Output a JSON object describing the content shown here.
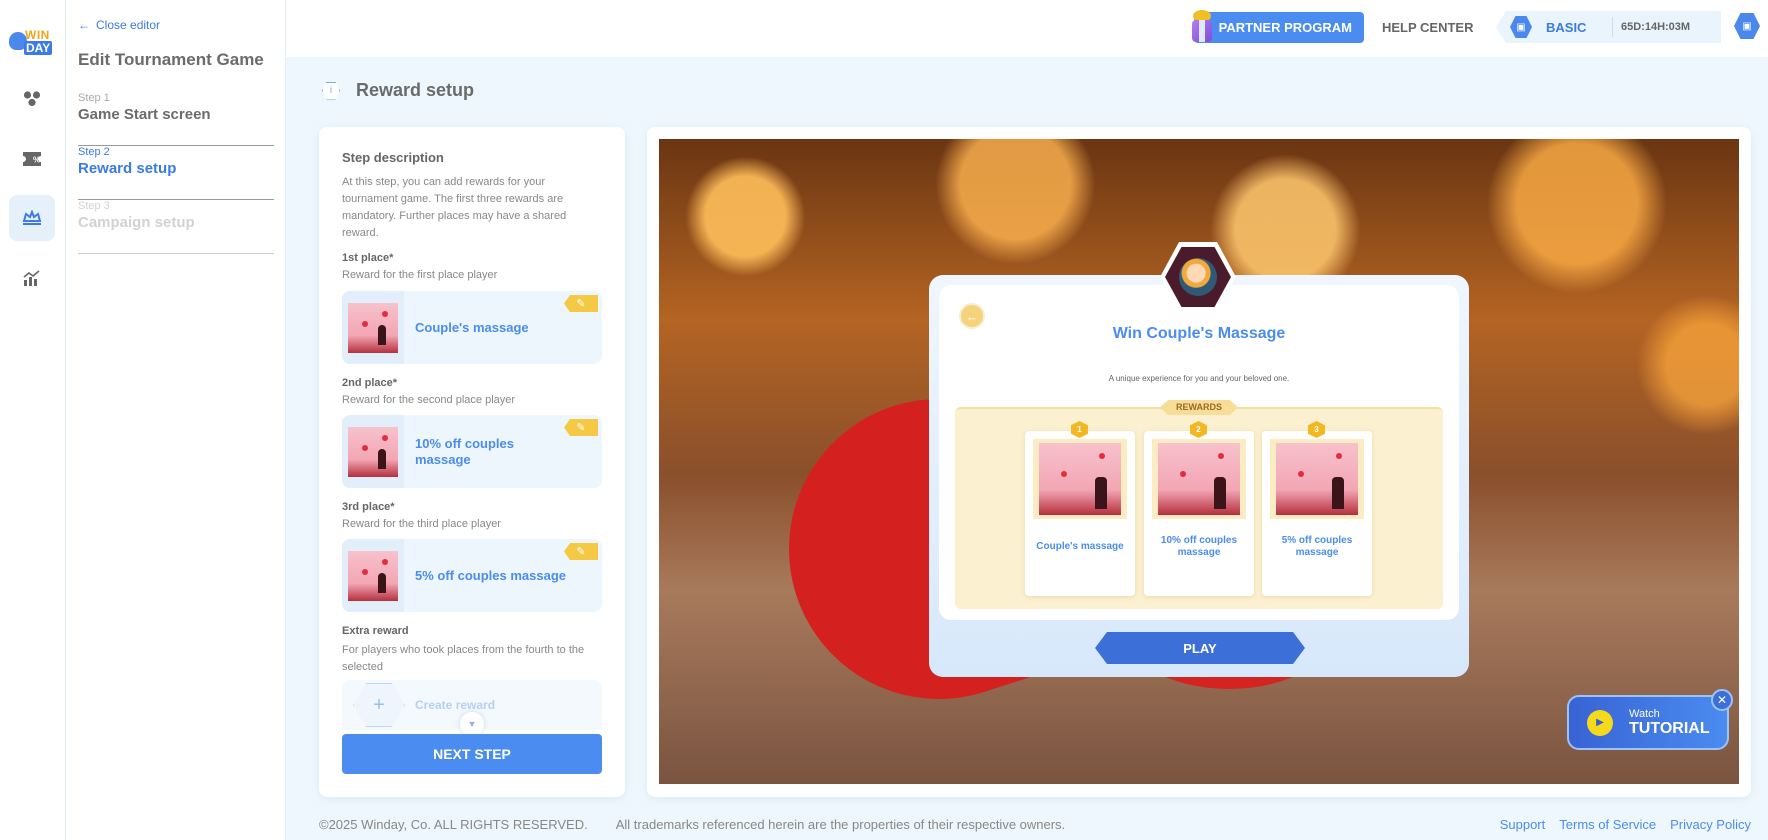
{
  "brand": {
    "logo_top": "WIN",
    "logo_bottom": "DAY"
  },
  "rail": {
    "items": [
      {
        "icon": "apps-icon",
        "active": false
      },
      {
        "icon": "coupon-icon",
        "active": false
      },
      {
        "icon": "crown-icon",
        "active": true
      },
      {
        "icon": "analytics-icon",
        "active": false
      }
    ]
  },
  "editor": {
    "close_label": "Close editor",
    "title": "Edit Tournament Game",
    "steps": [
      {
        "label": "Step 1",
        "name": "Game Start screen",
        "state": "done"
      },
      {
        "label": "Step 2",
        "name": "Reward setup",
        "state": "active"
      },
      {
        "label": "Step 3",
        "name": "Campaign setup",
        "state": "disabled"
      }
    ]
  },
  "topbar": {
    "partner_label": "PARTNER PROGRAM",
    "help_label": "HELP CENTER",
    "plan_name": "BASIC",
    "plan_timer": "65D:14H:03M"
  },
  "page": {
    "title": "Reward setup"
  },
  "step_panel": {
    "title": "Step description",
    "description": "At this step, you can add rewards for your tournament game. The first three rewards are mandatory. Further places may have a shared reward.",
    "places": [
      {
        "title": "1st place*",
        "subtitle": "Reward for the first place player",
        "reward": "Couple's massage"
      },
      {
        "title": "2nd place*",
        "subtitle": "Reward for the second place player",
        "reward": "10% off couples massage"
      },
      {
        "title": "3rd place*",
        "subtitle": "Reward for the third place player",
        "reward": "5% off couples massage"
      }
    ],
    "extra": {
      "title": "Extra reward",
      "subtitle": "For players who took places from the fourth to the selected",
      "create_label": "Create reward"
    },
    "next_label": "NEXT STEP"
  },
  "preview": {
    "title": "Win Couple's Massage",
    "description": "A unique experience for you and your beloved one.",
    "rewards_label": "REWARDS",
    "rewards": [
      {
        "rank": "1",
        "name": "Couple's massage"
      },
      {
        "rank": "2",
        "name": "10% off couples massage"
      },
      {
        "rank": "3",
        "name": "5% off couples massage"
      }
    ],
    "play_label": "PLAY"
  },
  "tutorial": {
    "line1": "Watch",
    "line2": "TUTORIAL"
  },
  "footer": {
    "copyright": "©2025 Winday, Co. ALL RIGHTS RESERVED.",
    "trademark": "All trademarks referenced herein are the properties of their respective owners.",
    "links": [
      "Support",
      "Terms of Service",
      "Privacy Policy"
    ]
  }
}
